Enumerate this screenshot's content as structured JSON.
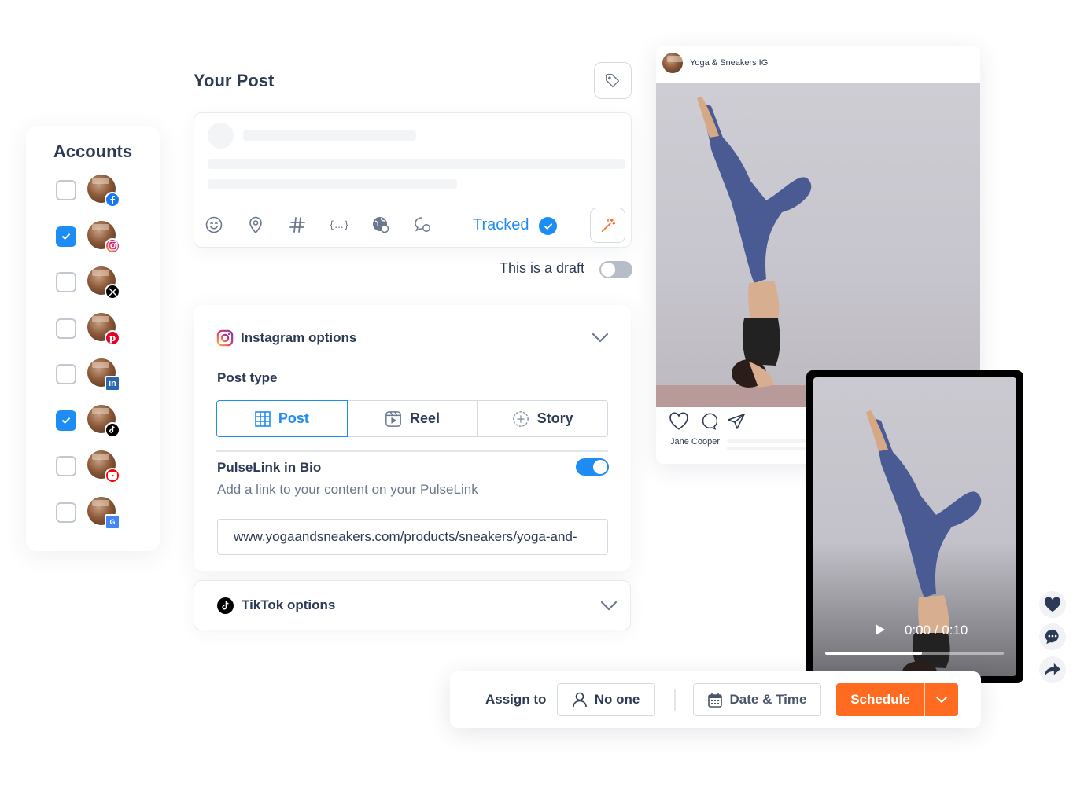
{
  "accounts": {
    "title": "Accounts",
    "items": [
      {
        "network": "Facebook",
        "checked": false,
        "badge_icon": "facebook-icon",
        "badge_color": "#1877f2"
      },
      {
        "network": "Instagram",
        "checked": true,
        "badge_icon": "instagram-icon",
        "badge_color": "#e1306c"
      },
      {
        "network": "X",
        "checked": false,
        "badge_icon": "x-icon",
        "badge_color": "#000000"
      },
      {
        "network": "Pinterest",
        "checked": false,
        "badge_icon": "pinterest-icon",
        "badge_color": "#e60023"
      },
      {
        "network": "LinkedIn",
        "checked": false,
        "badge_icon": "linkedin-icon",
        "badge_color": "#2867b2"
      },
      {
        "network": "TikTok",
        "checked": true,
        "badge_icon": "tiktok-icon",
        "badge_color": "#000000"
      },
      {
        "network": "YouTube",
        "checked": false,
        "badge_icon": "youtube-icon",
        "badge_color": "#ff0000"
      },
      {
        "network": "Google Business",
        "checked": false,
        "badge_icon": "google-business-icon",
        "badge_color": "#4285f4"
      }
    ]
  },
  "post": {
    "title": "Your Post",
    "tracked_label": "Tracked",
    "draft_label": "This is a draft",
    "draft_on": false,
    "toolbar": [
      "emoji-icon",
      "location-icon",
      "hashtag-icon",
      "variables-icon",
      "globe-gear-icon",
      "comment-gear-icon"
    ]
  },
  "instagram_options": {
    "title": "Instagram options",
    "post_type_label": "Post type",
    "post_types": [
      {
        "label": "Post",
        "active": true
      },
      {
        "label": "Reel",
        "active": false
      },
      {
        "label": "Story",
        "active": false
      }
    ],
    "pulselink_title": "PulseLink in Bio",
    "pulselink_on": true,
    "pulselink_desc": "Add a link to your content on your PulseLink",
    "url_value": "www.yogaandsneakers.com/products/sneakers/yoga-and-"
  },
  "tiktok_options": {
    "title": "TikTok options"
  },
  "ig_preview": {
    "account_name": "Yoga & Sneakers IG",
    "commenter": "Jane Cooper"
  },
  "video": {
    "time": "0:00 / 0:10",
    "progress": 0.54
  },
  "bottom_bar": {
    "assign_label": "Assign to",
    "assignee": "No one",
    "date_label": "Date & Time",
    "schedule_label": "Schedule"
  },
  "colors": {
    "accent": "#1e8cf5",
    "schedule": "#ff6b21",
    "text": "#2c3a55"
  }
}
